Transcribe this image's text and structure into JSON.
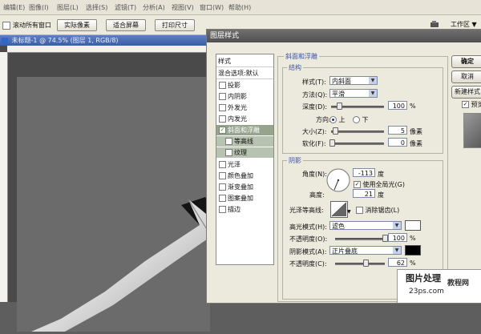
{
  "menu": [
    "编辑(E)",
    "图像(I)",
    "图层(L)",
    "选择(S)",
    "滤镜(T)",
    "分析(A)",
    "视图(V)",
    "窗口(W)",
    "帮助(H)"
  ],
  "options": {
    "scroll_all_label": "滚动所有窗口",
    "actual_pixels": "实际像素",
    "fit_screen": "适合屏幕",
    "print_size": "打印尺寸",
    "workspace": "工作区 ▼"
  },
  "document": {
    "title": "未标题-1 @ 74.5% (图层 1, RGB/8)"
  },
  "dialog": {
    "title": "图层样式",
    "styles_header": "样式",
    "blend_options": "混合选项:默认",
    "effects": [
      "投影",
      "内阴影",
      "外发光",
      "内发光",
      "斜面和浮雕",
      "等高线",
      "纹理",
      "光泽",
      "颜色叠加",
      "渐变叠加",
      "图案叠加",
      "描边"
    ],
    "bevel": {
      "group_title": "斜面和浮雕",
      "structure": "结构",
      "style_label": "样式(T):",
      "style_value": "内斜面",
      "technique_label": "方法(Q):",
      "technique_value": "平滑",
      "depth_label": "深度(D):",
      "depth_value": "100",
      "depth_percent": 100,
      "depth_unit": "%",
      "direction_label": "方向:",
      "dir_up": "上",
      "dir_down": "下",
      "size_label": "大小(Z):",
      "size_value": "5",
      "size_unit": "像素",
      "soften_label": "软化(F):",
      "soften_value": "0",
      "soften_unit": "像素"
    },
    "shading": {
      "title": "阴影",
      "angle_label": "角度(N):",
      "angle_value": "-113",
      "angle_unit": "度",
      "global_light": "使用全局光(G)",
      "altitude_label": "高度:",
      "altitude_value": "21",
      "altitude_unit": "度",
      "gloss_label": "光泽等高线:",
      "anti_alias": "消除锯齿(L)",
      "highlight_mode_label": "高光模式(H):",
      "highlight_mode": "滤色",
      "highlight_color": "#ffffff",
      "opacity_label": "不透明度(O):",
      "opacity_value": "100",
      "opacity_percent": 100,
      "opacity_unit": "%",
      "shadow_mode_label": "阴影模式(A):",
      "shadow_mode": "正片叠底",
      "shadow_color": "#000000",
      "opacity2_label": "不透明度(C):",
      "opacity2_value": "62",
      "opacity2_percent": 62,
      "opacity2_unit": "%"
    },
    "buttons": {
      "ok": "确定",
      "cancel": "取消",
      "new_style": "新建样式",
      "preview": "预览"
    }
  },
  "watermark": {
    "line1": "图片处理",
    "line1b": "教程网",
    "line2": "23ps.com"
  }
}
